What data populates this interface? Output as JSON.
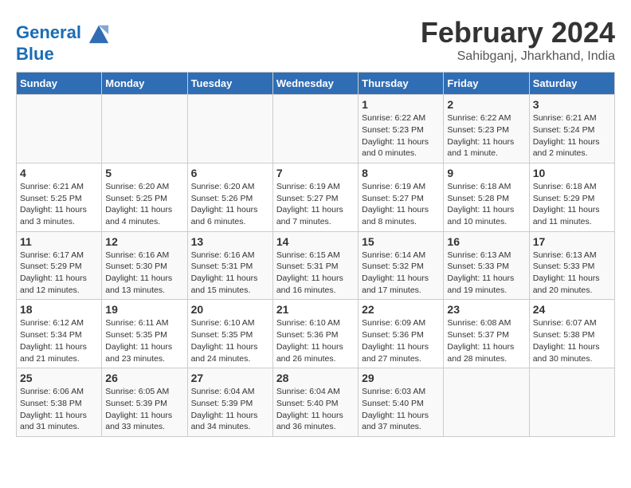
{
  "header": {
    "logo_line1": "General",
    "logo_line2": "Blue",
    "title": "February 2024",
    "subtitle": "Sahibganj, Jharkhand, India"
  },
  "days_of_week": [
    "Sunday",
    "Monday",
    "Tuesday",
    "Wednesday",
    "Thursday",
    "Friday",
    "Saturday"
  ],
  "weeks": [
    [
      {
        "num": "",
        "info": ""
      },
      {
        "num": "",
        "info": ""
      },
      {
        "num": "",
        "info": ""
      },
      {
        "num": "",
        "info": ""
      },
      {
        "num": "1",
        "info": "Sunrise: 6:22 AM\nSunset: 5:23 PM\nDaylight: 11 hours\nand 0 minutes."
      },
      {
        "num": "2",
        "info": "Sunrise: 6:22 AM\nSunset: 5:23 PM\nDaylight: 11 hours\nand 1 minute."
      },
      {
        "num": "3",
        "info": "Sunrise: 6:21 AM\nSunset: 5:24 PM\nDaylight: 11 hours\nand 2 minutes."
      }
    ],
    [
      {
        "num": "4",
        "info": "Sunrise: 6:21 AM\nSunset: 5:25 PM\nDaylight: 11 hours\nand 3 minutes."
      },
      {
        "num": "5",
        "info": "Sunrise: 6:20 AM\nSunset: 5:25 PM\nDaylight: 11 hours\nand 4 minutes."
      },
      {
        "num": "6",
        "info": "Sunrise: 6:20 AM\nSunset: 5:26 PM\nDaylight: 11 hours\nand 6 minutes."
      },
      {
        "num": "7",
        "info": "Sunrise: 6:19 AM\nSunset: 5:27 PM\nDaylight: 11 hours\nand 7 minutes."
      },
      {
        "num": "8",
        "info": "Sunrise: 6:19 AM\nSunset: 5:27 PM\nDaylight: 11 hours\nand 8 minutes."
      },
      {
        "num": "9",
        "info": "Sunrise: 6:18 AM\nSunset: 5:28 PM\nDaylight: 11 hours\nand 10 minutes."
      },
      {
        "num": "10",
        "info": "Sunrise: 6:18 AM\nSunset: 5:29 PM\nDaylight: 11 hours\nand 11 minutes."
      }
    ],
    [
      {
        "num": "11",
        "info": "Sunrise: 6:17 AM\nSunset: 5:29 PM\nDaylight: 11 hours\nand 12 minutes."
      },
      {
        "num": "12",
        "info": "Sunrise: 6:16 AM\nSunset: 5:30 PM\nDaylight: 11 hours\nand 13 minutes."
      },
      {
        "num": "13",
        "info": "Sunrise: 6:16 AM\nSunset: 5:31 PM\nDaylight: 11 hours\nand 15 minutes."
      },
      {
        "num": "14",
        "info": "Sunrise: 6:15 AM\nSunset: 5:31 PM\nDaylight: 11 hours\nand 16 minutes."
      },
      {
        "num": "15",
        "info": "Sunrise: 6:14 AM\nSunset: 5:32 PM\nDaylight: 11 hours\nand 17 minutes."
      },
      {
        "num": "16",
        "info": "Sunrise: 6:13 AM\nSunset: 5:33 PM\nDaylight: 11 hours\nand 19 minutes."
      },
      {
        "num": "17",
        "info": "Sunrise: 6:13 AM\nSunset: 5:33 PM\nDaylight: 11 hours\nand 20 minutes."
      }
    ],
    [
      {
        "num": "18",
        "info": "Sunrise: 6:12 AM\nSunset: 5:34 PM\nDaylight: 11 hours\nand 21 minutes."
      },
      {
        "num": "19",
        "info": "Sunrise: 6:11 AM\nSunset: 5:35 PM\nDaylight: 11 hours\nand 23 minutes."
      },
      {
        "num": "20",
        "info": "Sunrise: 6:10 AM\nSunset: 5:35 PM\nDaylight: 11 hours\nand 24 minutes."
      },
      {
        "num": "21",
        "info": "Sunrise: 6:10 AM\nSunset: 5:36 PM\nDaylight: 11 hours\nand 26 minutes."
      },
      {
        "num": "22",
        "info": "Sunrise: 6:09 AM\nSunset: 5:36 PM\nDaylight: 11 hours\nand 27 minutes."
      },
      {
        "num": "23",
        "info": "Sunrise: 6:08 AM\nSunset: 5:37 PM\nDaylight: 11 hours\nand 28 minutes."
      },
      {
        "num": "24",
        "info": "Sunrise: 6:07 AM\nSunset: 5:38 PM\nDaylight: 11 hours\nand 30 minutes."
      }
    ],
    [
      {
        "num": "25",
        "info": "Sunrise: 6:06 AM\nSunset: 5:38 PM\nDaylight: 11 hours\nand 31 minutes."
      },
      {
        "num": "26",
        "info": "Sunrise: 6:05 AM\nSunset: 5:39 PM\nDaylight: 11 hours\nand 33 minutes."
      },
      {
        "num": "27",
        "info": "Sunrise: 6:04 AM\nSunset: 5:39 PM\nDaylight: 11 hours\nand 34 minutes."
      },
      {
        "num": "28",
        "info": "Sunrise: 6:04 AM\nSunset: 5:40 PM\nDaylight: 11 hours\nand 36 minutes."
      },
      {
        "num": "29",
        "info": "Sunrise: 6:03 AM\nSunset: 5:40 PM\nDaylight: 11 hours\nand 37 minutes."
      },
      {
        "num": "",
        "info": ""
      },
      {
        "num": "",
        "info": ""
      }
    ]
  ]
}
